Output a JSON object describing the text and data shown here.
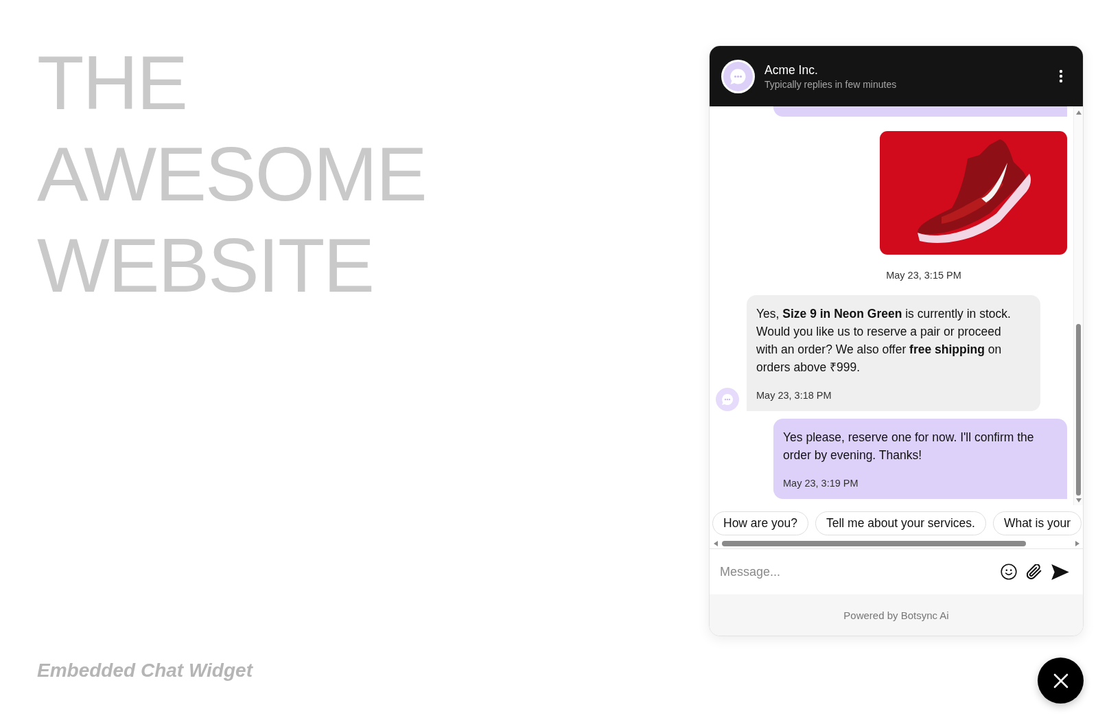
{
  "page": {
    "title": "THE AWESOME WEBSITE",
    "caption": "Embedded Chat Widget"
  },
  "chat_widget": {
    "header": {
      "name": "Acme Inc.",
      "status": "Typically replies in few minutes"
    },
    "messages": [
      {
        "outgoing": true,
        "kind": "clipped"
      },
      {
        "outgoing": true,
        "kind": "image",
        "time": "May 23, 3:15 PM"
      },
      {
        "outgoing": false,
        "kind": "text",
        "text": "Yes, **Size 9 in Neon Green** is currently in stock. Would you like us to reserve a pair or proceed with an order? We also offer **free shipping** on orders above ₹999.",
        "time": "May 23, 3:18 PM"
      },
      {
        "outgoing": true,
        "kind": "text",
        "text": "Yes please, reserve one for now. I'll confirm the order by evening. Thanks!",
        "time": "May 23, 3:19 PM"
      }
    ],
    "suggestions": [
      "How are you?",
      "Tell me about your services.",
      "What is your"
    ],
    "composer": {
      "placeholder": "Message..."
    },
    "footer": "Powered by Botsync Ai"
  }
}
